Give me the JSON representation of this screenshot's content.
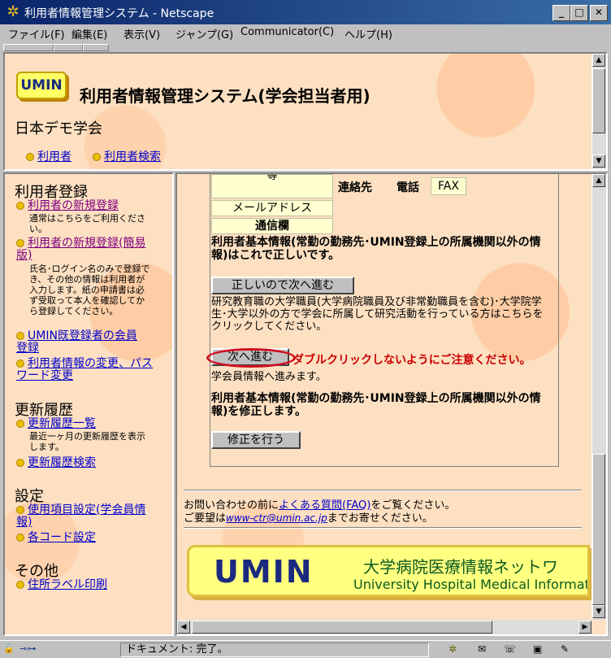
{
  "window": {
    "title": "利用者情報管理システム - Netscape"
  },
  "menu": [
    "ファイル(F)",
    "編集(E)",
    "表示(V)",
    "ジャンプ(G)",
    "Communicator(C)",
    "ヘルプ(H)"
  ],
  "header": {
    "logo": "UMIN",
    "title": "利用者情報管理システム(学会担当者用)",
    "society": "日本デモ学会",
    "links": [
      "利用者",
      "利用者検索"
    ]
  },
  "sidebar": {
    "sections": [
      {
        "title": "利用者登録"
      },
      {
        "title": "更新履歴"
      },
      {
        "title": "設定"
      },
      {
        "title": "その他"
      }
    ],
    "items": [
      {
        "label": "利用者の新規登録",
        "desc": "通常はこちらをご利用ください。"
      },
      {
        "label": "利用者の新規登録(簡易版)",
        "desc": "氏名･ログイン名のみで登録でき、その他の情報は利用者が入力します。紙の申請書は必ず受取って本人を確認してから登録してください。"
      },
      {
        "label": "UMIN既登録者の会員登録"
      },
      {
        "label": "利用者情報の変更、パスワード変更"
      },
      {
        "label": "更新履歴一覧",
        "desc": "最近一ヶ月の更新履歴を表示します。"
      },
      {
        "label": "更新履歴検索"
      },
      {
        "label": "使用項目設定(学会員情報)"
      },
      {
        "label": "各コード設定"
      },
      {
        "label": "住所ラベル印刷"
      }
    ]
  },
  "main": {
    "table": {
      "row_top_fragment": "等",
      "contact_label": "連絡先",
      "phone_label": "電話",
      "fax_label": "FAX",
      "email_label": "メールアドレス",
      "comm_label": "通信欄"
    },
    "confirm_text": "利用者基本情報(常勤の勤務先･UMIN登録上の所属機関以外の情報)はこれで正しいです。",
    "correct_button": "正しいので次へ進む",
    "correct_desc": "研究教育職の大学職員(大学病院職員及び非常勤職員を含む)･大学院学生･大学以外の方で学会に所属して研究活動を行っている方はこちらをクリックしてください。",
    "next_button": "次へ進む",
    "warning": "ダブルクリックしないようにご注意ください。",
    "next_desc": "学会員情報へ進みます。",
    "modify_text": "利用者基本情報(常勤の勤務先･UMIN登録上の所属機関以外の情報)を修正します。",
    "modify_button": "修正を行う",
    "footer_prefix": "お問い合わせの前に",
    "faq_link": "よくある質問(FAQ)",
    "footer_suffix": "をご覧ください。",
    "contact_prefix": "ご要望は",
    "email_link": "www-ctr@umin.ac.jp",
    "contact_suffix": "までお寄せください。",
    "banner": {
      "logo": "UMIN",
      "jp": "大学病院医療情報ネットワ",
      "en": "University Hospital Medical Informat"
    }
  },
  "status": {
    "text": "ドキュメント: 完了。"
  },
  "colors": {
    "peach": "#fde0c2",
    "link": "#0000cc",
    "warning": "#cc0000",
    "titlebar": "#0a246a"
  }
}
